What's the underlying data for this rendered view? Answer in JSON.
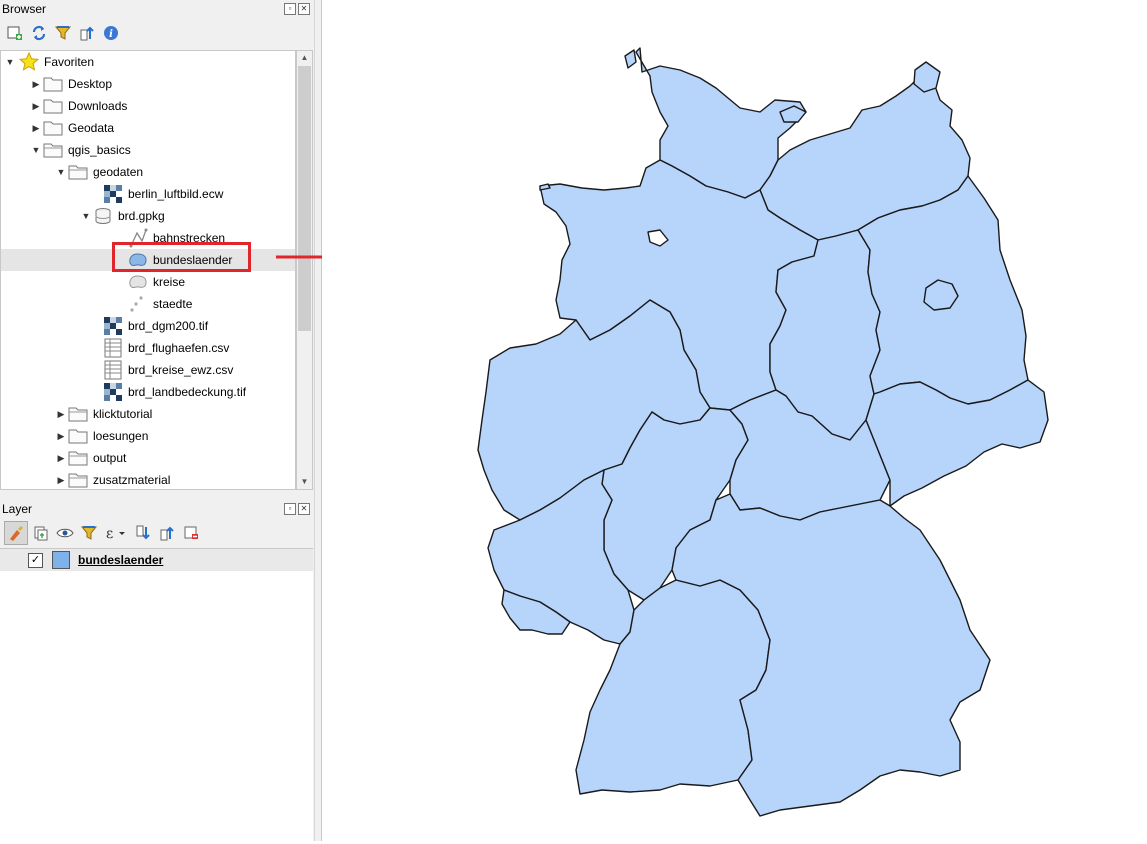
{
  "browser_panel": {
    "title": "Browser",
    "toolbar": [
      "add-layer-icon",
      "refresh-icon",
      "filter-icon",
      "collapse-all-icon",
      "info-icon"
    ],
    "tree": [
      {
        "label": "Favoriten",
        "icon": "star-icon",
        "expanded": true,
        "level": 0
      },
      {
        "label": "Desktop",
        "icon": "folder-icon",
        "expanded": false,
        "level": 1
      },
      {
        "label": "Downloads",
        "icon": "folder-icon",
        "expanded": false,
        "level": 1
      },
      {
        "label": "Geodata",
        "icon": "folder-icon",
        "expanded": false,
        "level": 1
      },
      {
        "label": "qgis_basics",
        "icon": "folder-icon",
        "expanded": true,
        "level": 1
      },
      {
        "label": "geodaten",
        "icon": "folder-icon",
        "expanded": true,
        "level": 2
      },
      {
        "label": "berlin_luftbild.ecw",
        "icon": "raster-icon",
        "level": 3
      },
      {
        "label": "brd.gpkg",
        "icon": "geopackage-icon",
        "expanded": true,
        "level": 3
      },
      {
        "label": "bahnstrecken",
        "icon": "line-layer-icon",
        "level": 4
      },
      {
        "label": "bundeslaender",
        "icon": "polygon-layer-icon",
        "level": 4,
        "selected": true
      },
      {
        "label": "kreise",
        "icon": "polygon-layer-icon",
        "level": 4
      },
      {
        "label": "staedte",
        "icon": "point-layer-icon",
        "level": 4
      },
      {
        "label": "brd_dgm200.tif",
        "icon": "raster-icon",
        "level": 3
      },
      {
        "label": "brd_flughaefen.csv",
        "icon": "table-icon",
        "level": 3
      },
      {
        "label": "brd_kreise_ewz.csv",
        "icon": "table-icon",
        "level": 3
      },
      {
        "label": "brd_landbedeckung.tif",
        "icon": "raster-icon",
        "level": 3
      },
      {
        "label": "klicktutorial",
        "icon": "folder-icon",
        "expanded": false,
        "level": 2
      },
      {
        "label": "loesungen",
        "icon": "folder-icon",
        "expanded": false,
        "level": 2
      },
      {
        "label": "output",
        "icon": "folder-icon",
        "expanded": false,
        "level": 2
      },
      {
        "label": "zusatzmaterial",
        "icon": "folder-icon",
        "expanded": false,
        "level": 2
      }
    ]
  },
  "layer_panel": {
    "title": "Layer",
    "toolbar": [
      "style-icon",
      "add-group-icon",
      "eye-icon",
      "filter-icon",
      "expression-icon",
      "expand-all-icon",
      "collapse-all-icon",
      "remove-layer-icon"
    ],
    "layers": [
      {
        "label": "bundeslaender",
        "checked": true,
        "swatch_color": "#7fb2ea"
      }
    ]
  },
  "map_canvas": {
    "fill_color": "#b7d4fb",
    "stroke_color": "#1a1a1a",
    "annotation_arrow_color": "#e0262a",
    "highlight_box_color": "#e0262a"
  }
}
